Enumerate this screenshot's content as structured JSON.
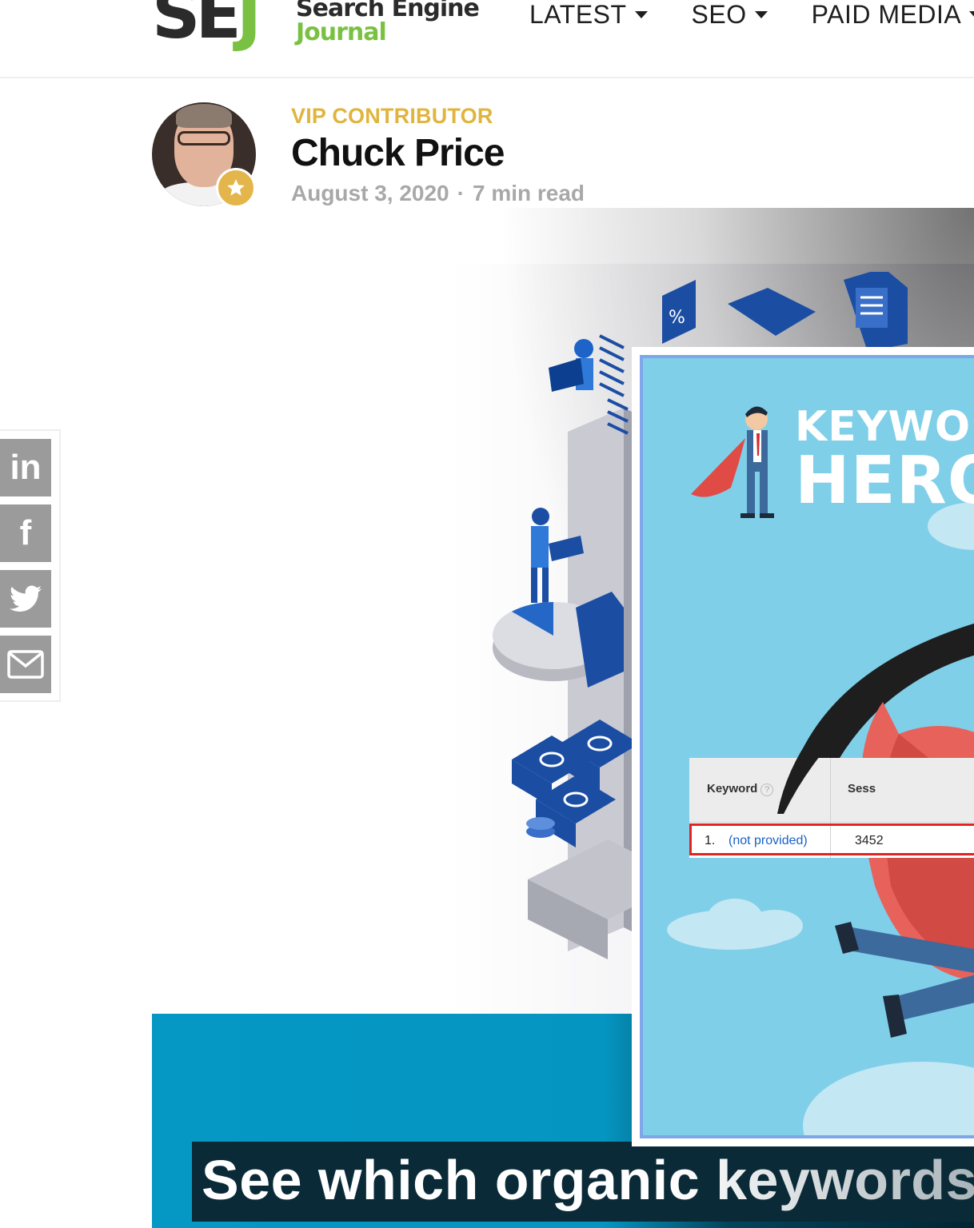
{
  "brand": {
    "logo_mark": "SEJ",
    "logo_line1": "Search Engine",
    "logo_line2": "Journal"
  },
  "nav": {
    "items": [
      {
        "label": "LATEST"
      },
      {
        "label": "SEO"
      },
      {
        "label": "PAID MEDIA"
      }
    ]
  },
  "author": {
    "badge": "VIP CONTRIBUTOR",
    "name": "Chuck Price",
    "date": "August 3, 2020",
    "separator": "·",
    "read_time": "7 min read"
  },
  "share": {
    "buttons": [
      {
        "icon": "linkedin-icon",
        "glyph": "in"
      },
      {
        "icon": "facebook-icon",
        "glyph": "f"
      },
      {
        "icon": "twitter-icon",
        "glyph": ""
      },
      {
        "icon": "email-icon",
        "glyph": ""
      }
    ]
  },
  "popup": {
    "title_line1": "KEYWOR",
    "title_line2": "HERO",
    "table": {
      "col1": "Keyword",
      "help": "?",
      "col2": "Sess",
      "row_num": "1.",
      "row_keyword": "(not provided)",
      "row_value": "3452"
    }
  },
  "banner": {
    "headline": "See which organic keywords"
  },
  "colors": {
    "sej_green": "#7ac143",
    "vip_gold": "#e0b43d",
    "banner_blue": "#0598c4",
    "popup_sky": "#7fcfe9"
  }
}
